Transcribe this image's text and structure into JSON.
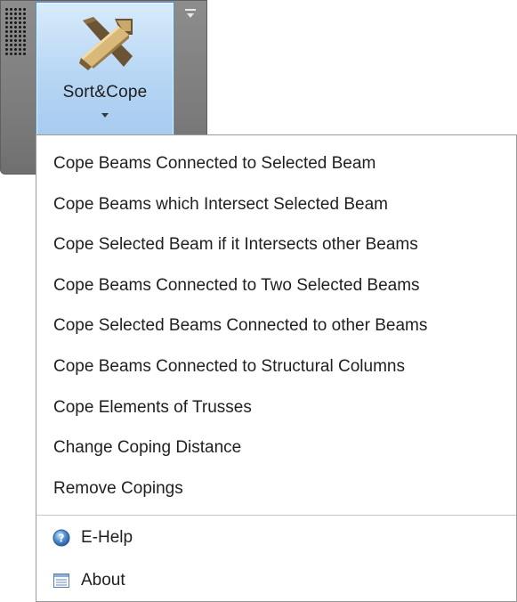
{
  "ribbon": {
    "button": {
      "label": "Sort&Cope",
      "icon": "crossed-beams-icon"
    },
    "panel_dropdown_icon": "panel-options-icon"
  },
  "menu": {
    "items": [
      {
        "label": "Cope Beams Connected to Selected Beam"
      },
      {
        "label": "Cope Beams which Intersect Selected Beam"
      },
      {
        "label": "Cope Selected Beam if it Intersects other Beams"
      },
      {
        "label": "Cope Beams Connected to Two Selected Beams"
      },
      {
        "label": "Cope Selected Beams Connected to other Beams"
      },
      {
        "label": "Cope Beams Connected to Structural Columns"
      },
      {
        "label": "Cope Elements of Trusses"
      },
      {
        "label": "Change Coping Distance"
      },
      {
        "label": "Remove Copings"
      }
    ],
    "footer_items": [
      {
        "label": "E-Help",
        "icon": "help-icon"
      },
      {
        "label": "About",
        "icon": "about-icon"
      }
    ]
  }
}
